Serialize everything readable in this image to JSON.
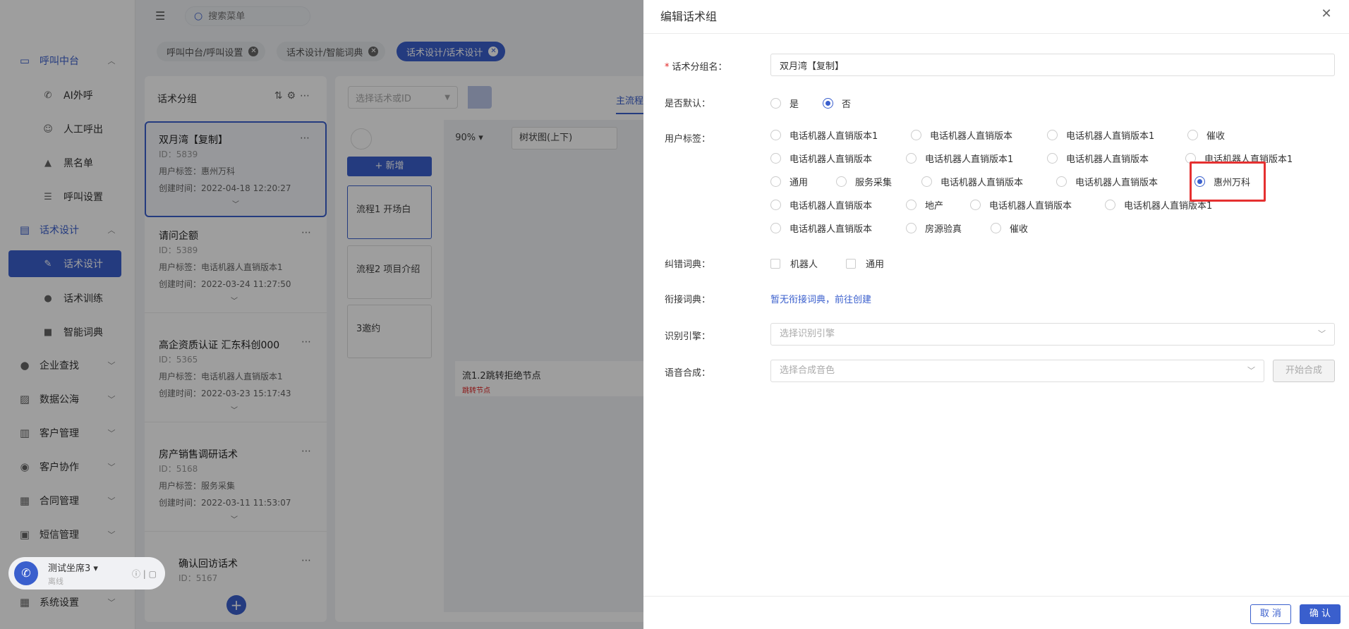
{
  "sidebar": {
    "groups": [
      {
        "label": "呼叫中台",
        "icon": "monitor-icon"
      },
      {
        "label": "话术设计",
        "icon": "book-icon"
      },
      {
        "label": "企业查找",
        "icon": "bulb-icon"
      },
      {
        "label": "数据公海",
        "icon": "image-icon"
      },
      {
        "label": "客户管理",
        "icon": "contacts-icon"
      },
      {
        "label": "客户协作",
        "icon": "share-icon"
      },
      {
        "label": "合同管理",
        "icon": "contract-icon"
      },
      {
        "label": "短信管理",
        "icon": "sms-icon"
      },
      {
        "label": "系统设置",
        "icon": "grid-icon"
      }
    ],
    "call_items": [
      "AI外呼",
      "人工呼出",
      "黑名单",
      "呼叫设置"
    ],
    "script_items": [
      "话术设计",
      "话术训练",
      "智能词典"
    ]
  },
  "topbar": {
    "search_placeholder": "搜索菜单"
  },
  "tabs": [
    {
      "label": "呼叫中台/呼叫设置"
    },
    {
      "label": "话术设计/智能词典"
    },
    {
      "label": "话术设计/话术设计"
    }
  ],
  "groups_panel": {
    "title": "话术分组",
    "tag_prefix": "用户标签：",
    "time_prefix": "创建时间：",
    "cards": [
      {
        "name": "双月湾【复制】",
        "id": "ID：5839",
        "tag": "惠州万科",
        "time": "2022-04-18 12:20:27"
      },
      {
        "name": "请问企额",
        "id": "ID：5389",
        "tag": "电话机器人直销版本1",
        "time": "2022-03-24 11:27:50"
      },
      {
        "name": "高企资质认证 汇东科创000",
        "id": "ID：5365",
        "tag": "电话机器人直销版本1",
        "time": "2022-03-23 15:17:43"
      },
      {
        "name": "房产销售调研话术",
        "id": "ID：5168",
        "tag": "服务采集",
        "time": "2022-03-11 11:53:07"
      },
      {
        "name": "确认回访话术",
        "id": "ID：5167"
      }
    ]
  },
  "flow": {
    "select_placeholder": "选择话术或ID",
    "tab": "主流程",
    "new_button": "+ 新增",
    "steps": [
      "流程1 开场白",
      "流程2 项目介绍",
      "3邀约"
    ],
    "zoom": "90%",
    "layout": "树状图(上下)",
    "node_title": "流1.2跳转拒绝节点",
    "node_sub": "跳转节点"
  },
  "seat": {
    "name": "测试坐席3",
    "status": "离线"
  },
  "drawer": {
    "title": "编辑话术组",
    "labels": {
      "name": "话术分组名：",
      "default": "是否默认：",
      "tags": "用户标签：",
      "correction": "纠错词典：",
      "link": "衔接词典：",
      "engine": "识别引擎：",
      "tts": "语音合成："
    },
    "name_value": "双月湾【复制】",
    "default_options": [
      "是",
      "否"
    ],
    "default_selected": "否",
    "tag_options": [
      [
        "电话机器人直销版本1",
        "电话机器人直销版本",
        "电话机器人直销版本1",
        "催收"
      ],
      [
        "电话机器人直销版本",
        "电话机器人直销版本1",
        "电话机器人直销版本",
        "电话机器人直销版本1"
      ],
      [
        "通用",
        "服务采集",
        "电话机器人直销版本",
        "电话机器人直销版本",
        "惠州万科"
      ],
      [
        "电话机器人直销版本",
        "地产",
        "电话机器人直销版本",
        "电话机器人直销版本1"
      ],
      [
        "电话机器人直销版本",
        "房源验真",
        "催收"
      ]
    ],
    "tag_selected": "惠州万科",
    "correction_options": [
      "机器人",
      "通用"
    ],
    "link_text": "暂无衔接词典，前往创建",
    "engine_placeholder": "选择识别引擎",
    "tts_placeholder": "选择合成音色",
    "tts_button": "开始合成",
    "cancel": "取 消",
    "confirm": "确 认"
  }
}
